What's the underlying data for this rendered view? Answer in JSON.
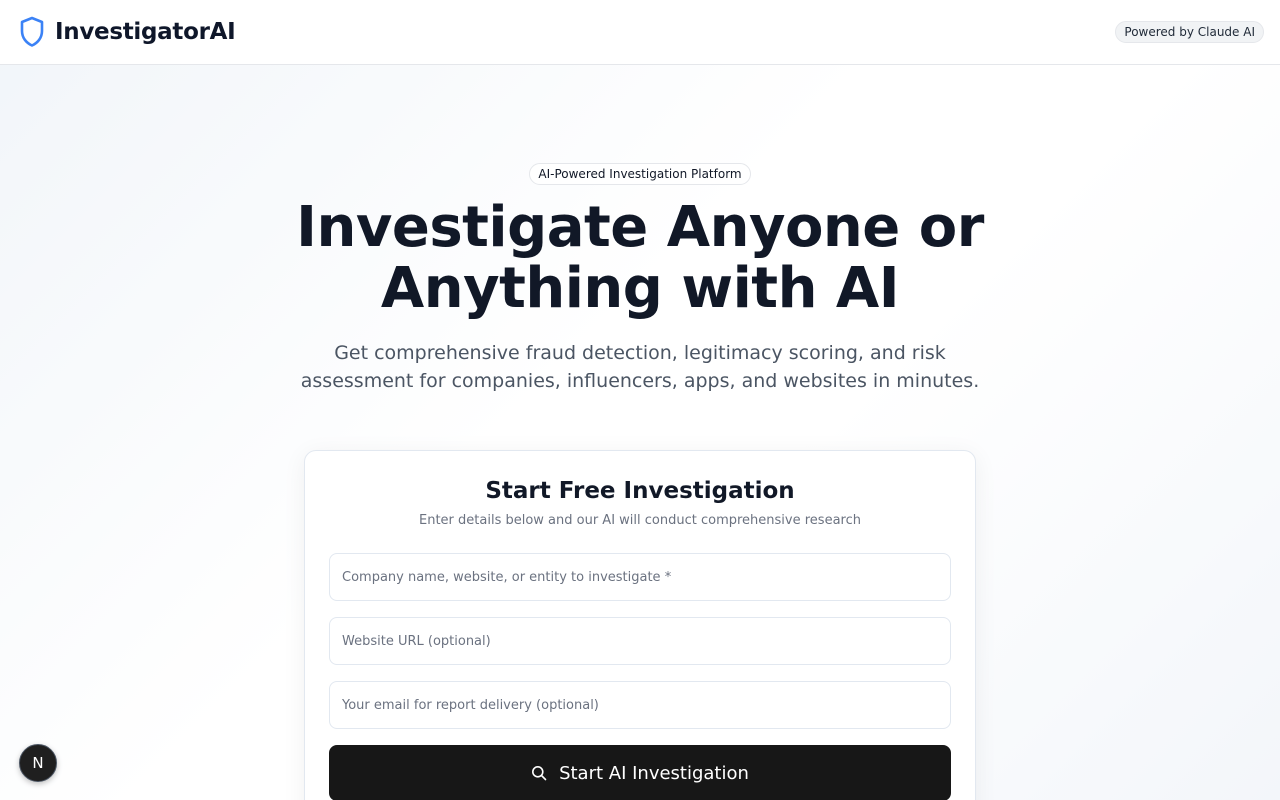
{
  "header": {
    "brand_name": "InvestigatorAI",
    "brand_icon": "shield-icon",
    "powered_badge": "Powered by Claude AI"
  },
  "hero": {
    "badge": "AI-Powered Investigation Platform",
    "title": "Investigate Anyone or Anything with AI",
    "subtitle": "Get comprehensive fraud detection, legitimacy scoring, and risk assessment for companies, influencers, apps, and websites in minutes."
  },
  "form": {
    "title": "Start Free Investigation",
    "subtitle": "Enter details below and our AI will conduct comprehensive research",
    "entity_placeholder": "Company name, website, or entity to investigate *",
    "url_placeholder": "Website URL (optional)",
    "email_placeholder": "Your email for report delivery (optional)",
    "submit_label": "Start AI Investigation",
    "submit_icon": "search-icon"
  },
  "dev_badge": {
    "label": "N",
    "icon": "nextjs-icon"
  },
  "colors": {
    "brand_accent": "#3b82f6",
    "button_bg": "#171717",
    "title_text": "#111827",
    "muted_text": "#6b7280"
  }
}
